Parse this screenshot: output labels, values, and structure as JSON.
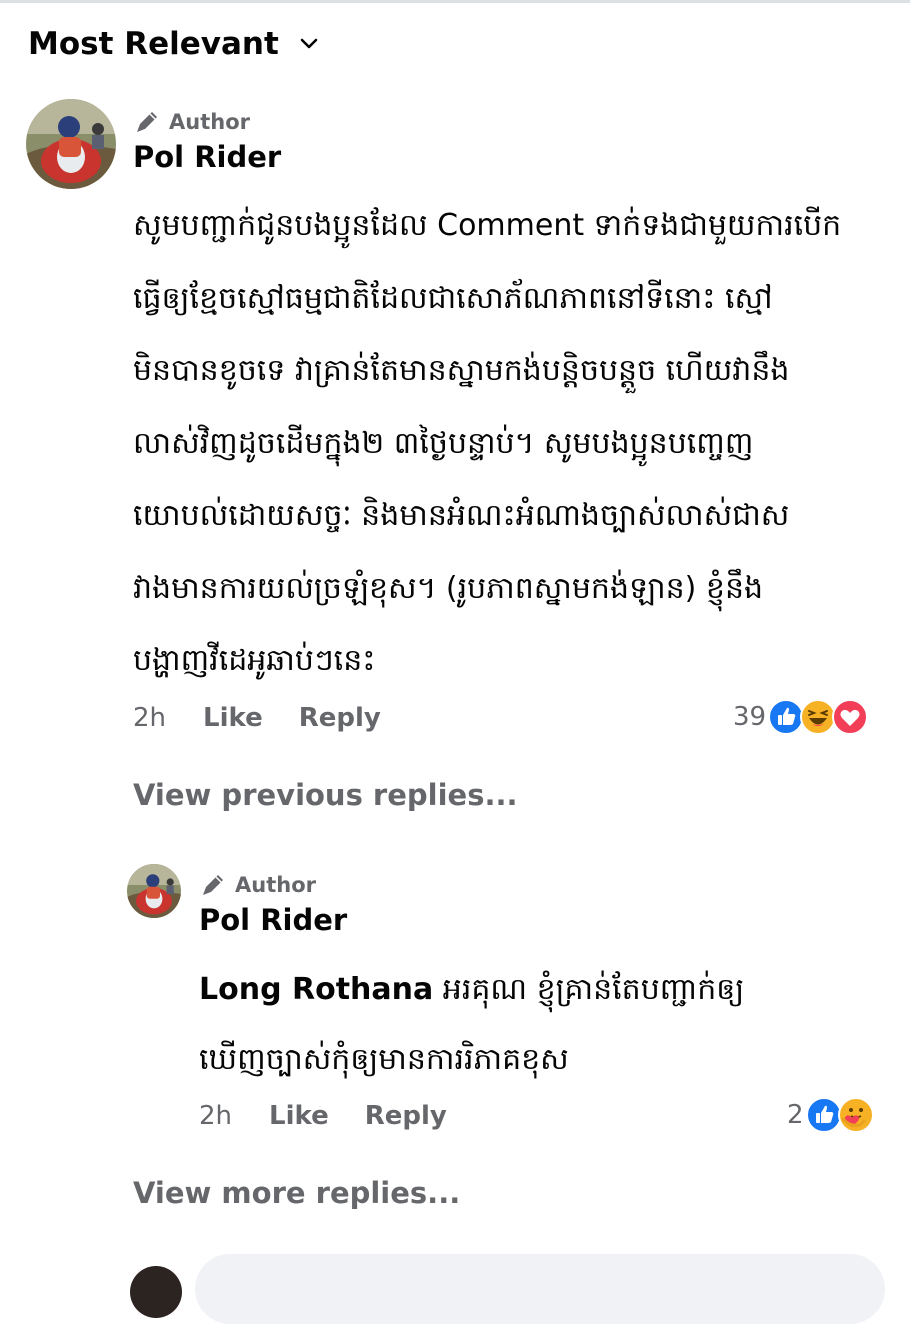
{
  "sort": {
    "label": "Most Relevant"
  },
  "comment": {
    "badge": "Author",
    "name": "Pol Rider",
    "text": "សូមបញ្ជាក់ជូនបងប្អូនដែល Comment ទាក់ទងជាមួយការបើក\nធ្វើឲ្យខ្មែចស្មៅធម្មជាតិដែលជាសោភ័ណភាពនៅទីនោះ ស្មៅ\nមិនបានខូចទេ វាគ្រាន់តែមានស្នាមកង់បន្តិចបន្តួច ហើយវានឹង\nលាស់វិញដូចដើមក្នុង២ ៣ថ្ងៃបន្ទាប់។ សូមបងប្អូនបញ្ចេញ\nយោបល់ដោយសច្ចៈ និងមានអំណះអំណាងច្បាស់លាស់ជាស\nវាងមានការយល់ច្រឡំខុស។ (រូបភាពស្នាមកង់ឡាន) ខ្ញុំនឹង\nបង្ហាញវីដេអូឆាប់ៗនេះ",
    "time": "2h",
    "like": "Like",
    "reply": "Reply",
    "reaction_count": "39",
    "reactions": [
      "like-icon",
      "haha-icon",
      "love-icon"
    ]
  },
  "view_previous": "View previous replies...",
  "reply": {
    "badge": "Author",
    "name": "Pol Rider",
    "mention": "Long Rothana",
    "text_line1": " អរគុណ ខ្ញុំគ្រាន់តែបញ្ជាក់ឲ្យ",
    "text_line2": "ឃើញច្បាស់កុំឲ្យមានការរិភាគខុស",
    "time": "2h",
    "like": "Like",
    "reply": "Reply",
    "reaction_count": "2",
    "reactions": [
      "like-icon",
      "care-icon"
    ]
  },
  "view_more": "View more replies...",
  "colors": {
    "secondary": "#65676b",
    "like_blue": "#1877f2",
    "love_red": "#f33e58",
    "haha_yellow": "#f7b125"
  }
}
